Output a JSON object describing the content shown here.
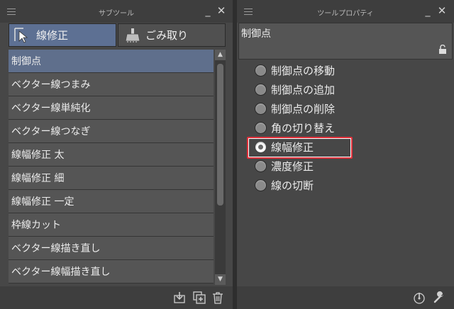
{
  "sub_tool": {
    "title": "サブツール",
    "tabs": [
      {
        "label": "線修正",
        "icon": "line-correction-icon",
        "selected": true
      },
      {
        "label": "ごみ取り",
        "icon": "dust-removal-icon",
        "selected": false
      }
    ],
    "items": [
      {
        "label": "制御点",
        "selected": true
      },
      {
        "label": "ベクター線つまみ"
      },
      {
        "label": "ベクター線単純化"
      },
      {
        "label": "ベクター線つなぎ"
      },
      {
        "label": "線幅修正 太"
      },
      {
        "label": "線幅修正 細"
      },
      {
        "label": "線幅修正 一定"
      },
      {
        "label": "枠線カット"
      },
      {
        "label": "ベクター線描き直し"
      },
      {
        "label": "ベクター線幅描き直し"
      }
    ]
  },
  "tool_property": {
    "title": "ツールプロパティ",
    "header_label": "制御点",
    "options": [
      {
        "label": "制御点の移動",
        "checked": false
      },
      {
        "label": "制御点の追加",
        "checked": false
      },
      {
        "label": "制御点の削除",
        "checked": false
      },
      {
        "label": "角の切り替え",
        "checked": false
      },
      {
        "label": "線幅修正",
        "checked": true
      },
      {
        "label": "濃度修正",
        "checked": false
      },
      {
        "label": "線の切断",
        "checked": false
      }
    ]
  },
  "colors": {
    "selected_item": "#5f6f8c",
    "selected_tab": "#5d7093",
    "highlight": "#e0303a"
  }
}
